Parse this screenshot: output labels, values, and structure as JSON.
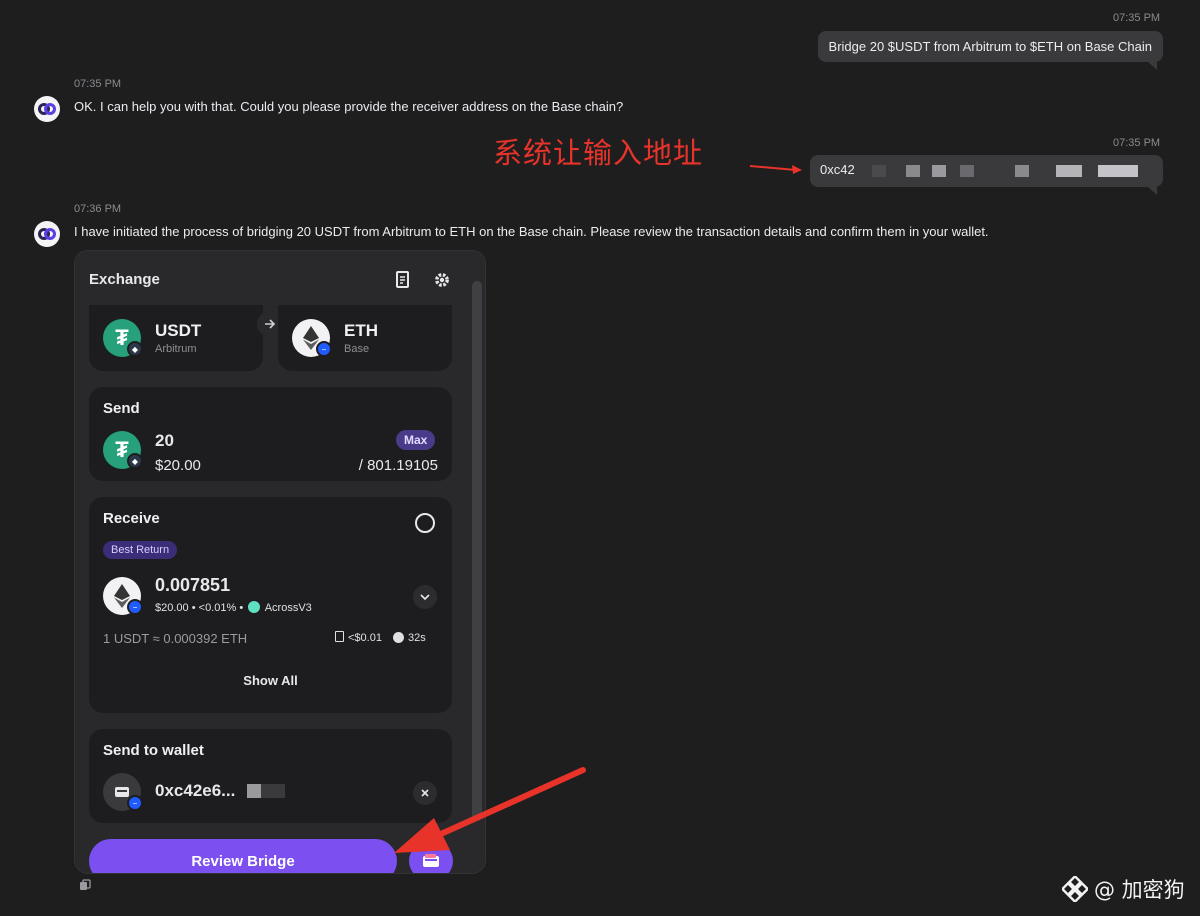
{
  "chat": {
    "msg1": {
      "time": "07:35 PM",
      "text": "Bridge 20 $USDT from Arbitrum to $ETH on Base Chain"
    },
    "msg2": {
      "time": "07:35 PM",
      "text": "OK. I can help you with that. Could you please provide the receiver address on the Base chain?"
    },
    "msg3": {
      "time": "07:35 PM",
      "text": "0xc42"
    },
    "msg4": {
      "time": "07:36 PM",
      "text": "I have initiated the process of bridging 20 USDT from Arbitrum to ETH on the Base chain. Please review the transaction details and confirm them in your wallet."
    }
  },
  "annotation": {
    "text": "系统让输入地址",
    "color": "#e8332a"
  },
  "widget": {
    "title": "Exchange",
    "icons": {
      "receipt": "receipt-icon",
      "settings": "gear-icon"
    },
    "from": {
      "symbol": "USDT",
      "network": "Arbitrum"
    },
    "to": {
      "symbol": "ETH",
      "network": "Base"
    },
    "send": {
      "title": "Send",
      "amount": "20",
      "usd": "$20.00",
      "max_label": "Max",
      "balance": "/ 801.19105"
    },
    "receive": {
      "title": "Receive",
      "best_label": "Best Return",
      "amount": "0.007851",
      "usd": "$20.00",
      "sep": "•",
      "impact": "<0.01%",
      "route": "AcrossV3",
      "rate": "1 USDT ≈ 0.000392 ETH",
      "gas": "<$0.01",
      "eta": "32s",
      "show_all": "Show All"
    },
    "wallet": {
      "title": "Send to wallet",
      "address": "0xc42e6..."
    },
    "review_label": "Review Bridge"
  },
  "watermark": {
    "text": "@ 加密狗"
  },
  "colors": {
    "accent": "#7b4ff0",
    "usdt": "#26a17b",
    "background": "#1e1e1f"
  }
}
